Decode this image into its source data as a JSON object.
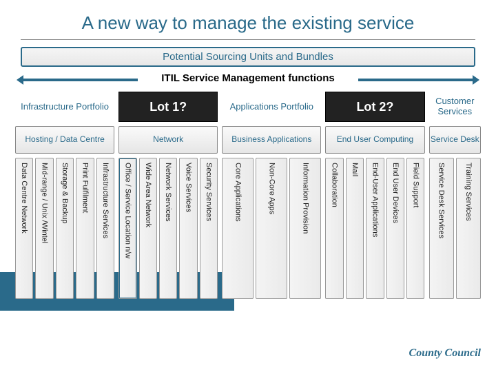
{
  "title": "A new way to manage the existing service",
  "sub_banner": "Potential Sourcing Units and Bundles",
  "itil_label": "ITIL Service Management functions",
  "columns": {
    "infra": {
      "header": "Infrastructure Portfolio",
      "mid": "Hosting / Data Centre",
      "verts": [
        "Data Centre Network",
        "Mid-range / Unix /Wintel",
        "Storage & Backup",
        "Print Fulfilment",
        "Infrastructure Services"
      ]
    },
    "lot1": {
      "header": "Lot 1?",
      "mid": "Network",
      "verts": [
        "Office / Service Location n/w",
        "Wide Area Network",
        "Network Services",
        "Voice Services",
        "Security Services"
      ]
    },
    "apps": {
      "header": "Applications Portfolio",
      "mid": "Business Applications",
      "verts": [
        "Core Applications",
        "Non-Core Apps",
        "Information Provision"
      ]
    },
    "lot2": {
      "header": "Lot 2?",
      "mid": "End User Computing",
      "verts": [
        "Collaboration",
        "Mail",
        "End-User Applications",
        "End User Devices",
        "Field Support"
      ]
    },
    "cust": {
      "header": "Customer Services",
      "mid": "Service Desk",
      "verts": [
        "Service Desk Services",
        "Training Services"
      ]
    }
  },
  "footer_brand": "County Council"
}
